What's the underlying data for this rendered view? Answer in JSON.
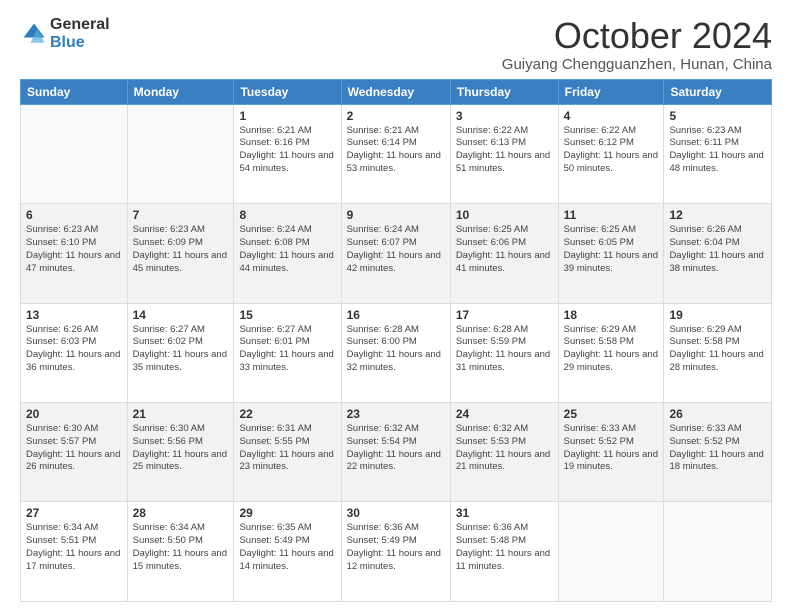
{
  "logo": {
    "general": "General",
    "blue": "Blue"
  },
  "title": "October 2024",
  "location": "Guiyang Chengguanzhen, Hunan, China",
  "weekdays": [
    "Sunday",
    "Monday",
    "Tuesday",
    "Wednesday",
    "Thursday",
    "Friday",
    "Saturday"
  ],
  "weeks": [
    [
      {
        "num": "",
        "detail": ""
      },
      {
        "num": "",
        "detail": ""
      },
      {
        "num": "1",
        "detail": "Sunrise: 6:21 AM\nSunset: 6:16 PM\nDaylight: 11 hours and 54 minutes."
      },
      {
        "num": "2",
        "detail": "Sunrise: 6:21 AM\nSunset: 6:14 PM\nDaylight: 11 hours and 53 minutes."
      },
      {
        "num": "3",
        "detail": "Sunrise: 6:22 AM\nSunset: 6:13 PM\nDaylight: 11 hours and 51 minutes."
      },
      {
        "num": "4",
        "detail": "Sunrise: 6:22 AM\nSunset: 6:12 PM\nDaylight: 11 hours and 50 minutes."
      },
      {
        "num": "5",
        "detail": "Sunrise: 6:23 AM\nSunset: 6:11 PM\nDaylight: 11 hours and 48 minutes."
      }
    ],
    [
      {
        "num": "6",
        "detail": "Sunrise: 6:23 AM\nSunset: 6:10 PM\nDaylight: 11 hours and 47 minutes."
      },
      {
        "num": "7",
        "detail": "Sunrise: 6:23 AM\nSunset: 6:09 PM\nDaylight: 11 hours and 45 minutes."
      },
      {
        "num": "8",
        "detail": "Sunrise: 6:24 AM\nSunset: 6:08 PM\nDaylight: 11 hours and 44 minutes."
      },
      {
        "num": "9",
        "detail": "Sunrise: 6:24 AM\nSunset: 6:07 PM\nDaylight: 11 hours and 42 minutes."
      },
      {
        "num": "10",
        "detail": "Sunrise: 6:25 AM\nSunset: 6:06 PM\nDaylight: 11 hours and 41 minutes."
      },
      {
        "num": "11",
        "detail": "Sunrise: 6:25 AM\nSunset: 6:05 PM\nDaylight: 11 hours and 39 minutes."
      },
      {
        "num": "12",
        "detail": "Sunrise: 6:26 AM\nSunset: 6:04 PM\nDaylight: 11 hours and 38 minutes."
      }
    ],
    [
      {
        "num": "13",
        "detail": "Sunrise: 6:26 AM\nSunset: 6:03 PM\nDaylight: 11 hours and 36 minutes."
      },
      {
        "num": "14",
        "detail": "Sunrise: 6:27 AM\nSunset: 6:02 PM\nDaylight: 11 hours and 35 minutes."
      },
      {
        "num": "15",
        "detail": "Sunrise: 6:27 AM\nSunset: 6:01 PM\nDaylight: 11 hours and 33 minutes."
      },
      {
        "num": "16",
        "detail": "Sunrise: 6:28 AM\nSunset: 6:00 PM\nDaylight: 11 hours and 32 minutes."
      },
      {
        "num": "17",
        "detail": "Sunrise: 6:28 AM\nSunset: 5:59 PM\nDaylight: 11 hours and 31 minutes."
      },
      {
        "num": "18",
        "detail": "Sunrise: 6:29 AM\nSunset: 5:58 PM\nDaylight: 11 hours and 29 minutes."
      },
      {
        "num": "19",
        "detail": "Sunrise: 6:29 AM\nSunset: 5:58 PM\nDaylight: 11 hours and 28 minutes."
      }
    ],
    [
      {
        "num": "20",
        "detail": "Sunrise: 6:30 AM\nSunset: 5:57 PM\nDaylight: 11 hours and 26 minutes."
      },
      {
        "num": "21",
        "detail": "Sunrise: 6:30 AM\nSunset: 5:56 PM\nDaylight: 11 hours and 25 minutes."
      },
      {
        "num": "22",
        "detail": "Sunrise: 6:31 AM\nSunset: 5:55 PM\nDaylight: 11 hours and 23 minutes."
      },
      {
        "num": "23",
        "detail": "Sunrise: 6:32 AM\nSunset: 5:54 PM\nDaylight: 11 hours and 22 minutes."
      },
      {
        "num": "24",
        "detail": "Sunrise: 6:32 AM\nSunset: 5:53 PM\nDaylight: 11 hours and 21 minutes."
      },
      {
        "num": "25",
        "detail": "Sunrise: 6:33 AM\nSunset: 5:52 PM\nDaylight: 11 hours and 19 minutes."
      },
      {
        "num": "26",
        "detail": "Sunrise: 6:33 AM\nSunset: 5:52 PM\nDaylight: 11 hours and 18 minutes."
      }
    ],
    [
      {
        "num": "27",
        "detail": "Sunrise: 6:34 AM\nSunset: 5:51 PM\nDaylight: 11 hours and 17 minutes."
      },
      {
        "num": "28",
        "detail": "Sunrise: 6:34 AM\nSunset: 5:50 PM\nDaylight: 11 hours and 15 minutes."
      },
      {
        "num": "29",
        "detail": "Sunrise: 6:35 AM\nSunset: 5:49 PM\nDaylight: 11 hours and 14 minutes."
      },
      {
        "num": "30",
        "detail": "Sunrise: 6:36 AM\nSunset: 5:49 PM\nDaylight: 11 hours and 12 minutes."
      },
      {
        "num": "31",
        "detail": "Sunrise: 6:36 AM\nSunset: 5:48 PM\nDaylight: 11 hours and 11 minutes."
      },
      {
        "num": "",
        "detail": ""
      },
      {
        "num": "",
        "detail": ""
      }
    ]
  ]
}
